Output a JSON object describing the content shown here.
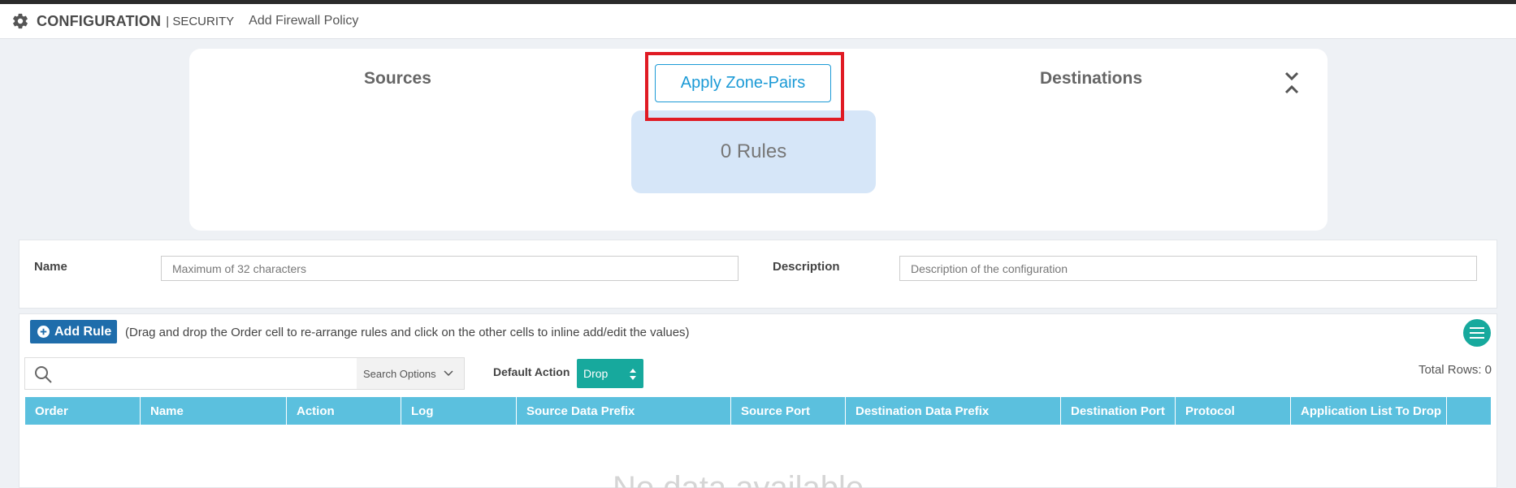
{
  "header": {
    "icon": "gear-icon",
    "section": "CONFIGURATION",
    "subsection": "| SECURITY",
    "breadcrumb": "Add Firewall Policy"
  },
  "policy": {
    "sources_label": "Sources",
    "destinations_label": "Destinations",
    "apply_button": "Apply Zone-Pairs",
    "rules_count": "0 Rules",
    "highlight_color": "#e01b24"
  },
  "form": {
    "name_label": "Name",
    "name_placeholder": "Maximum of 32 characters",
    "description_label": "Description",
    "description_placeholder": "Description of the configuration"
  },
  "rules": {
    "add_rule_label": "Add Rule",
    "hint": "(Drag and drop the Order cell to re-arrange rules and click on the other cells to inline add/edit the values)",
    "search_placeholder": "",
    "search_options_label": "Search Options",
    "default_action_label": "Default Action",
    "default_action_value": "Drop",
    "total_rows": "Total Rows: 0",
    "columns": [
      "Order",
      "Name",
      "Action",
      "Log",
      "Source Data Prefix",
      "Source Port",
      "Destination Data Prefix",
      "Destination Port",
      "Protocol",
      "Application List To Drop",
      ""
    ],
    "empty_text": "No data available"
  },
  "colors": {
    "accent_blue": "#1b9ad6",
    "header_table": "#5bc0de",
    "teal": "#17a99d",
    "add_rule_bg": "#1f6dab"
  }
}
